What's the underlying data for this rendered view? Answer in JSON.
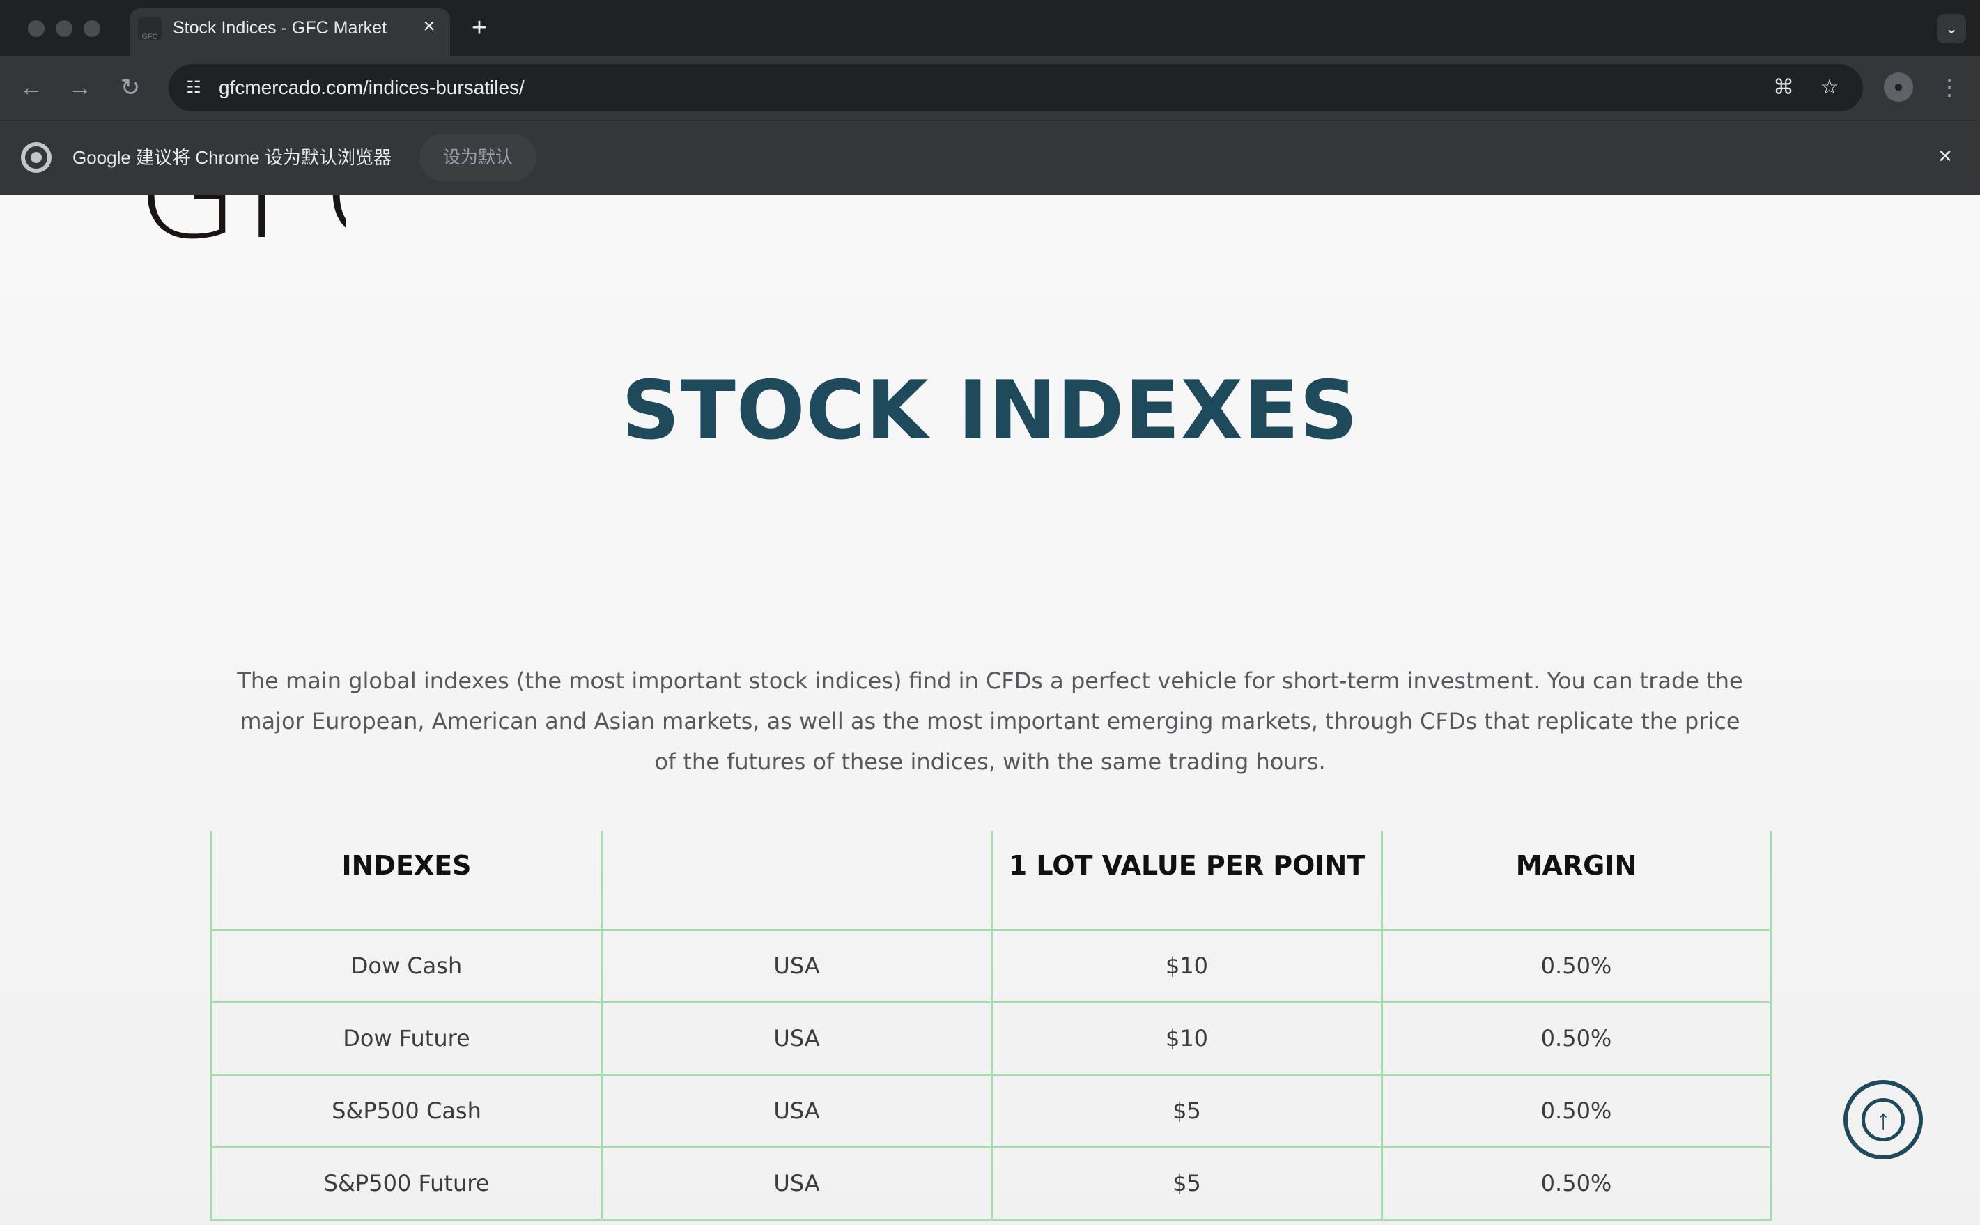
{
  "browser": {
    "tab_title": "Stock Indices - GFC Market",
    "tab_favicon_text": "GFC",
    "url": "gfcmercado.com/indices-bursatiles/",
    "infobar_text": "Google 建议将 Chrome 设为默认浏览器",
    "infobar_button": "设为默认"
  },
  "page": {
    "logo": "GFC",
    "title": "STOCK INDEXES",
    "intro": "The main global indexes (the most important stock indices) find in CFDs a perfect vehicle for short-term investment. You can trade the major European, American and Asian markets, as well as the most important emerging markets, through CFDs that replicate the price of the futures of these indices, with the same trading hours."
  },
  "table": {
    "headers": [
      "INDEXES",
      "",
      "1 LOT VALUE PER POINT",
      "MARGIN"
    ],
    "rows": [
      [
        "Dow Cash",
        "USA",
        "$10",
        "0.50%"
      ],
      [
        "Dow Future",
        "USA",
        "$10",
        "0.50%"
      ],
      [
        "S&P500 Cash",
        "USA",
        "$5",
        "0.50%"
      ],
      [
        "S&P500 Future",
        "USA",
        "$5",
        "0.50%"
      ]
    ]
  },
  "icons": {
    "back": "arrow-left-icon",
    "forward": "arrow-right-icon",
    "reload": "reload-icon",
    "translate": "translate-icon",
    "bookmark": "star-icon",
    "profile": "profile-icon",
    "menu": "more-vert-icon",
    "scroll_top": "arrow-up-circle-icon"
  },
  "colors": {
    "title": "#1f4a5c",
    "table_border": "#a6dbae",
    "chrome_dark": "#202124",
    "chrome_toolbar": "#35363a"
  }
}
